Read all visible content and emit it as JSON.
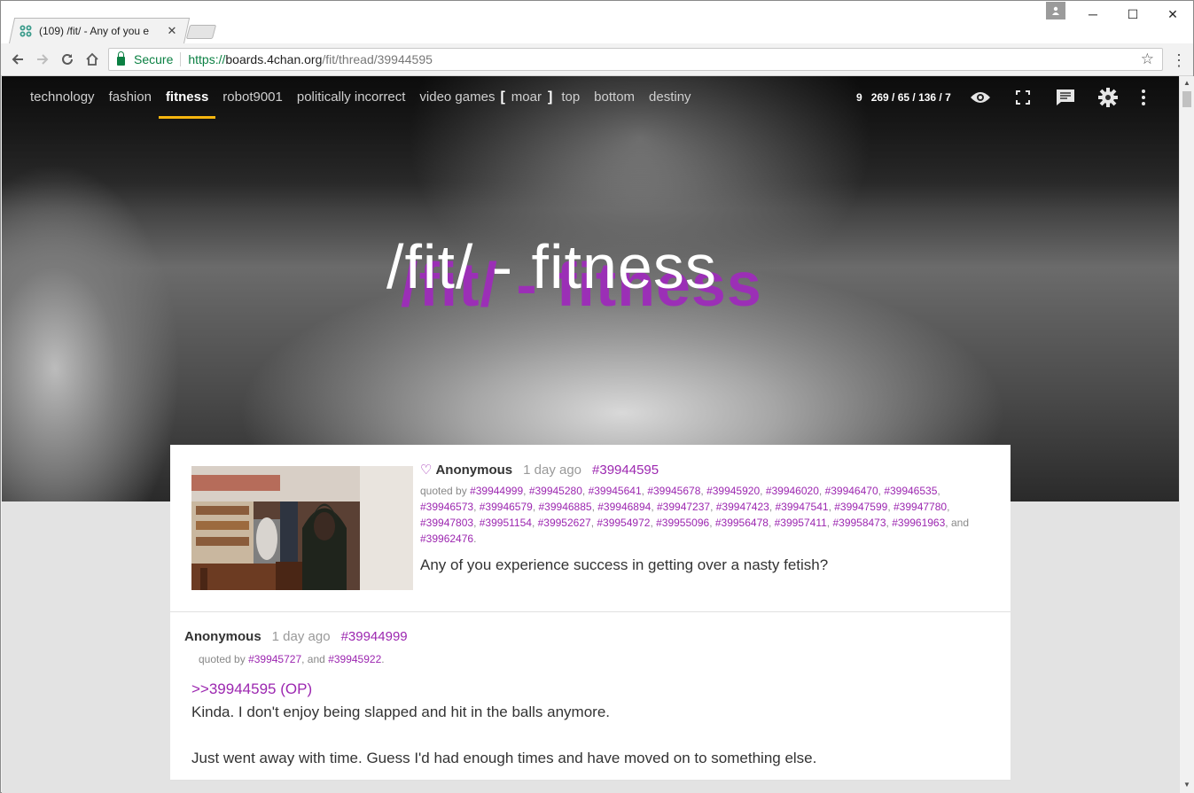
{
  "browser": {
    "tab_title": "(109) /fit/ - Any of you e",
    "tab_close": "✕",
    "secure_label": "Secure",
    "url_scheme": "https://",
    "url_host": "boards.4chan.org",
    "url_path": "/fit/thread/39944595",
    "window_controls": {
      "minimize": "─",
      "maximize": "☐",
      "close": "✕"
    }
  },
  "nav": {
    "links": [
      "technology",
      "fashion",
      "fitness",
      "robot9001",
      "politically incorrect",
      "video games"
    ],
    "active": "fitness",
    "bracket_open": "[",
    "moar": "moar",
    "bracket_close": "]",
    "top": "top",
    "bottom": "bottom",
    "destiny": "destiny",
    "stats_count": "9",
    "stats": "269 / 65 / 136 / 7",
    "icons": [
      "eye-icon",
      "fullscreen-icon",
      "comment-icon",
      "settings-icon",
      "more-vert-icon"
    ]
  },
  "board": {
    "title": "/fit/ - fitness",
    "title_shadow": "/fit/ - fitness",
    "accent": "#9c27b0",
    "nav_underline": "#f5b50f"
  },
  "op": {
    "name": "Anonymous",
    "time": "1 day ago",
    "id": "#39944595",
    "quoted_label": "quoted by",
    "quoted_by": [
      "#39944999",
      "#39945280",
      "#39945641",
      "#39945678",
      "#39945920",
      "#39946020",
      "#39946470",
      "#39946535",
      "#39946573",
      "#39946579",
      "#39946885",
      "#39946894",
      "#39947237",
      "#39947423",
      "#39947541",
      "#39947599",
      "#39947780",
      "#39947803",
      "#39951154",
      "#39952627",
      "#39954972",
      "#39955096",
      "#39956478",
      "#39957411",
      "#39958473",
      "#39961963"
    ],
    "quoted_tail_sep": ", and",
    "quoted_last": "#39962476",
    "text": "Any of you experience success in getting over a nasty fetish?"
  },
  "reply": {
    "name": "Anonymous",
    "time": "1 day ago",
    "id": "#39944999",
    "quoted_label": "quoted by",
    "quoted_1": "#39945727",
    "quoted_and": ", and",
    "quoted_2": "#39945922",
    "quote_link": ">>39944595 (OP)",
    "line1": "Kinda. I don't enjoy being slapped and hit in the balls anymore.",
    "line2": "Just went away with time. Guess I'd had enough times and have moved on to something else."
  }
}
